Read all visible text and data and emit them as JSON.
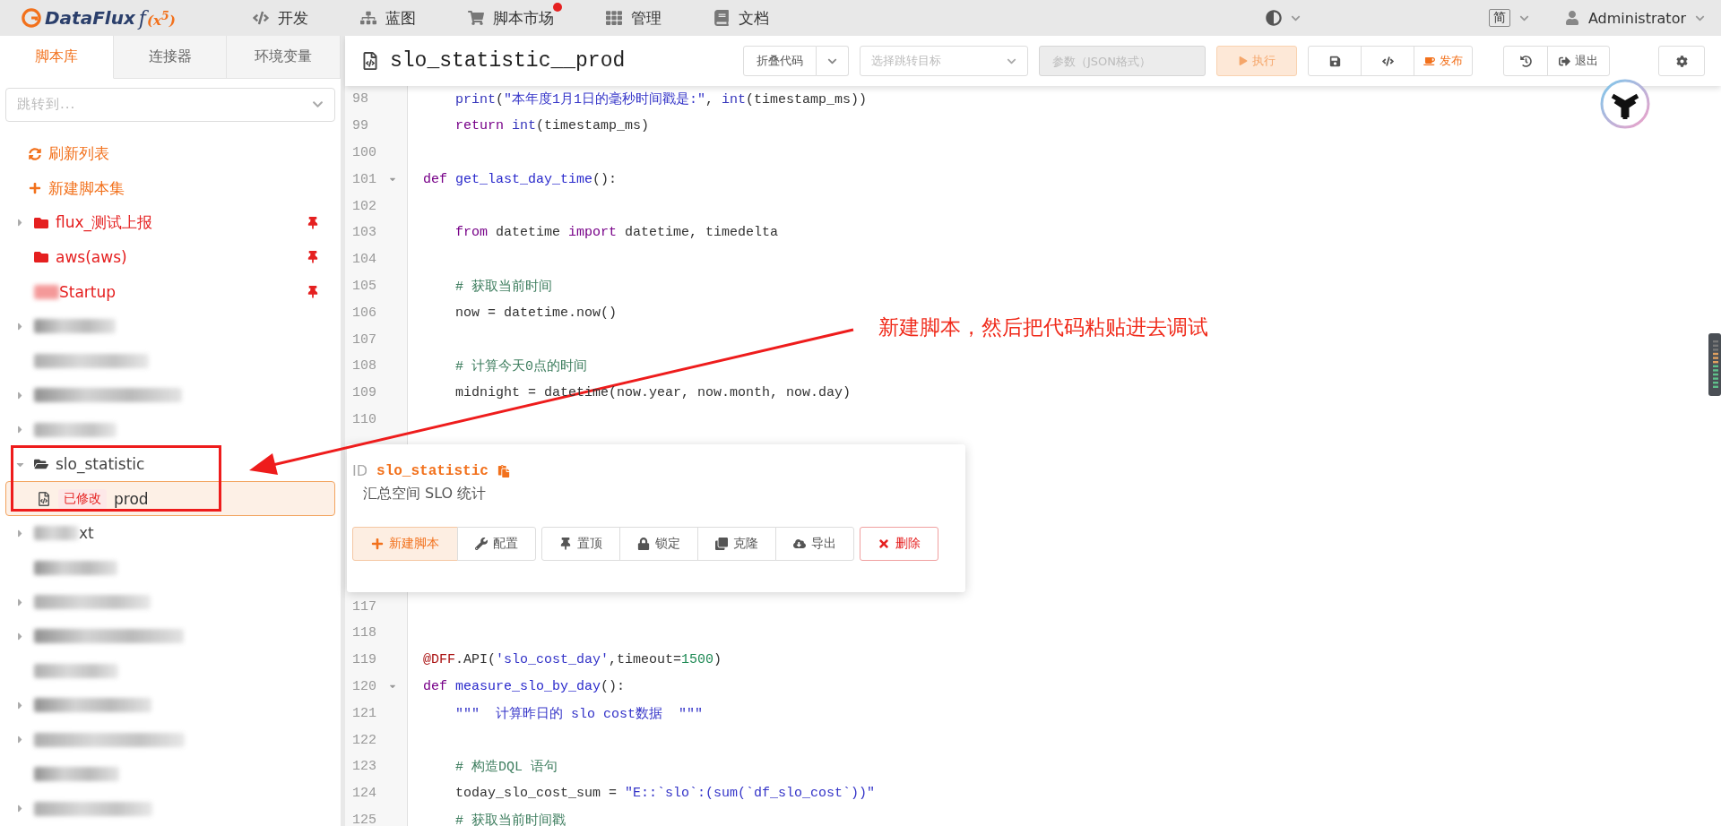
{
  "nav": {
    "logo": {
      "name": "DataFlux",
      "fx": "f",
      "power": "(x$^{5}$)"
    },
    "items": [
      {
        "label": "开发"
      },
      {
        "label": "蓝图"
      },
      {
        "label": "脚本市场",
        "badge": true
      },
      {
        "label": "管理"
      },
      {
        "label": "文档"
      }
    ],
    "language": "简",
    "user": "Administrator"
  },
  "sidebar": {
    "tabs": [
      {
        "label": "脚本库",
        "selected": true
      },
      {
        "label": "连接器",
        "selected": false
      },
      {
        "label": "环境变量",
        "selected": false
      }
    ],
    "jump": {
      "placeholder": "跳转到..."
    },
    "actions": [
      {
        "label": "刷新列表"
      },
      {
        "label": "新建脚本集"
      }
    ],
    "tree": [
      {
        "kind": "folder",
        "label": "flux_测试上报",
        "pinned": true,
        "expandable": true,
        "expanded": false
      },
      {
        "kind": "folder",
        "label": "aws(aws)",
        "pinned": true,
        "expandable": false
      },
      {
        "kind": "partial",
        "label": "Startup",
        "pinned": true,
        "expandable": false
      },
      {
        "kind": "redacted",
        "expandable": true
      },
      {
        "kind": "redacted",
        "expandable": false
      },
      {
        "kind": "redacted",
        "expandable": true
      },
      {
        "kind": "redacted",
        "expandable": true
      },
      {
        "kind": "folder",
        "label": "slo_statistic",
        "expandable": true,
        "expanded": true,
        "children": [
          {
            "kind": "script",
            "label": "prod",
            "badge": "已修改",
            "selected": true
          }
        ]
      },
      {
        "kind": "partial",
        "label": "xt",
        "expandable": true
      },
      {
        "kind": "redacted",
        "expandable": false
      },
      {
        "kind": "redacted",
        "expandable": true
      },
      {
        "kind": "redacted",
        "expandable": true
      },
      {
        "kind": "redacted",
        "expandable": false
      },
      {
        "kind": "redacted",
        "expandable": true
      },
      {
        "kind": "redacted",
        "expandable": true
      },
      {
        "kind": "redacted",
        "expandable": false
      },
      {
        "kind": "redacted",
        "expandable": true
      }
    ]
  },
  "editor": {
    "title": "slo_statistic__prod",
    "toolbar": {
      "fold": "折叠代码",
      "jump_target": {
        "placeholder": "选择跳转目标"
      },
      "params": {
        "placeholder": "参数（JSON格式）",
        "disabled": true
      },
      "run": {
        "label": "执行",
        "disabled": true
      },
      "publish": "发布",
      "exit": "退出"
    },
    "lines_top": [
      {
        "n": "98",
        "tokens": [
          {
            "kind": "builtin",
            "text": "    print"
          },
          {
            "kind": "plain",
            "text": "("
          },
          {
            "kind": "string",
            "text": "\"本年度1月1日的毫秒时间戳是:\""
          },
          {
            "kind": "plain",
            "text": ", "
          },
          {
            "kind": "builtin",
            "text": "int"
          },
          {
            "kind": "plain",
            "text": "(timestamp_ms))"
          }
        ]
      },
      {
        "n": "99",
        "tokens": [
          {
            "kind": "keyword",
            "text": "    return "
          },
          {
            "kind": "builtin",
            "text": "int"
          },
          {
            "kind": "plain",
            "text": "(timestamp_ms)"
          }
        ]
      },
      {
        "n": "100"
      },
      {
        "n": "101",
        "fold": true,
        "tokens": [
          {
            "kind": "keyword",
            "text": "def "
          },
          {
            "kind": "function",
            "text": "get_last_day_time"
          },
          {
            "kind": "plain",
            "text": "():"
          }
        ]
      },
      {
        "n": "102"
      },
      {
        "n": "103",
        "tokens": [
          {
            "kind": "keyword",
            "text": "    from"
          },
          {
            "kind": "plain",
            "text": " datetime "
          },
          {
            "kind": "keyword",
            "text": "import"
          },
          {
            "kind": "plain",
            "text": " datetime, timedelta"
          }
        ]
      },
      {
        "n": "104"
      },
      {
        "n": "105",
        "tokens": [
          {
            "kind": "comment",
            "text": "    # 获取当前时间"
          }
        ]
      },
      {
        "n": "106",
        "tokens": [
          {
            "kind": "plain",
            "text": "    now = datetime.now()"
          }
        ]
      },
      {
        "n": "107"
      },
      {
        "n": "108",
        "tokens": [
          {
            "kind": "comment",
            "text": "    # 计算今天0点的时间"
          }
        ]
      },
      {
        "n": "109",
        "tokens": [
          {
            "kind": "plain",
            "text": "    midnight = datetime(now.year, now.month, now.day)"
          }
        ]
      },
      {
        "n": "110"
      }
    ],
    "lines_bottom": [
      {
        "n": "117"
      },
      {
        "n": "118"
      },
      {
        "n": "119",
        "tokens": [
          {
            "kind": "decorator",
            "text": "@DFF"
          },
          {
            "kind": "plain",
            "text": ".API("
          },
          {
            "kind": "string",
            "text": "'slo_cost_day'"
          },
          {
            "kind": "plain",
            "text": ",timeout="
          },
          {
            "kind": "number",
            "text": "1500"
          },
          {
            "kind": "plain",
            "text": ")"
          }
        ]
      },
      {
        "n": "120",
        "fold": true,
        "tokens": [
          {
            "kind": "keyword",
            "text": "def "
          },
          {
            "kind": "function",
            "text": "measure_slo_by_day"
          },
          {
            "kind": "plain",
            "text": "():"
          }
        ]
      },
      {
        "n": "121",
        "tokens": [
          {
            "kind": "string",
            "text": "    \"\"\"  计算昨日的 slo cost数据  \"\"\""
          }
        ]
      },
      {
        "n": "122"
      },
      {
        "n": "123",
        "tokens": [
          {
            "kind": "comment",
            "text": "    # 构造DQL 语句"
          }
        ]
      },
      {
        "n": "124",
        "tokens": [
          {
            "kind": "plain",
            "text": "    today_slo_cost_sum = "
          },
          {
            "kind": "string",
            "text": "\"E::`slo`:(sum(`df_slo_cost`))\""
          }
        ]
      },
      {
        "n": "125",
        "tokens": [
          {
            "kind": "comment",
            "text": "    # 获取当前时间戳"
          }
        ]
      }
    ],
    "popup": {
      "id_label": "ID",
      "id": "slo_statistic",
      "description": "汇总空间 SLO 统计",
      "groups": [
        [
          {
            "label": "新建脚本",
            "kind": "primary"
          },
          {
            "label": "配置",
            "kind": "normal"
          }
        ],
        [
          {
            "label": "置顶",
            "kind": "normal"
          },
          {
            "label": "锁定",
            "kind": "normal"
          },
          {
            "label": "克隆",
            "kind": "normal"
          },
          {
            "label": "导出",
            "kind": "normal"
          }
        ],
        [
          {
            "label": "删除",
            "kind": "danger"
          }
        ]
      ]
    }
  },
  "annotation": {
    "text": "新建脚本，然后把代码粘贴进去调试"
  }
}
